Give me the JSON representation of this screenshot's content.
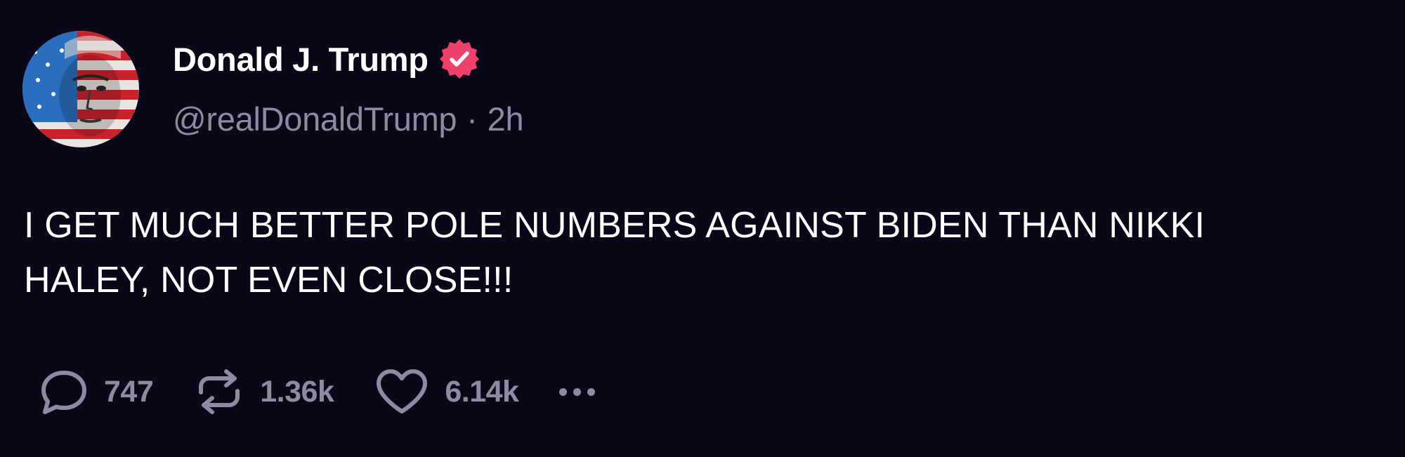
{
  "author": {
    "display_name": "Donald J. Trump",
    "handle": "@realDonaldTrump",
    "separator": "·",
    "timestamp": "2h",
    "verified_icon": "verified-badge-icon",
    "verified_color": "#f0416c"
  },
  "post": {
    "text": "I GET MUCH BETTER POLE NUMBERS AGAINST BIDEN THAN NIKKI\nHALEY, NOT EVEN CLOSE!!!"
  },
  "actions": {
    "replies": {
      "icon": "reply-icon",
      "count": "747"
    },
    "reposts": {
      "icon": "repost-icon",
      "count": "1.36k"
    },
    "likes": {
      "icon": "heart-icon",
      "count": "6.14k"
    },
    "more": {
      "icon": "more-icon"
    }
  },
  "colors": {
    "background": "#0a0818",
    "primary_text": "#ffffff",
    "secondary_text": "#8e8b9e"
  }
}
